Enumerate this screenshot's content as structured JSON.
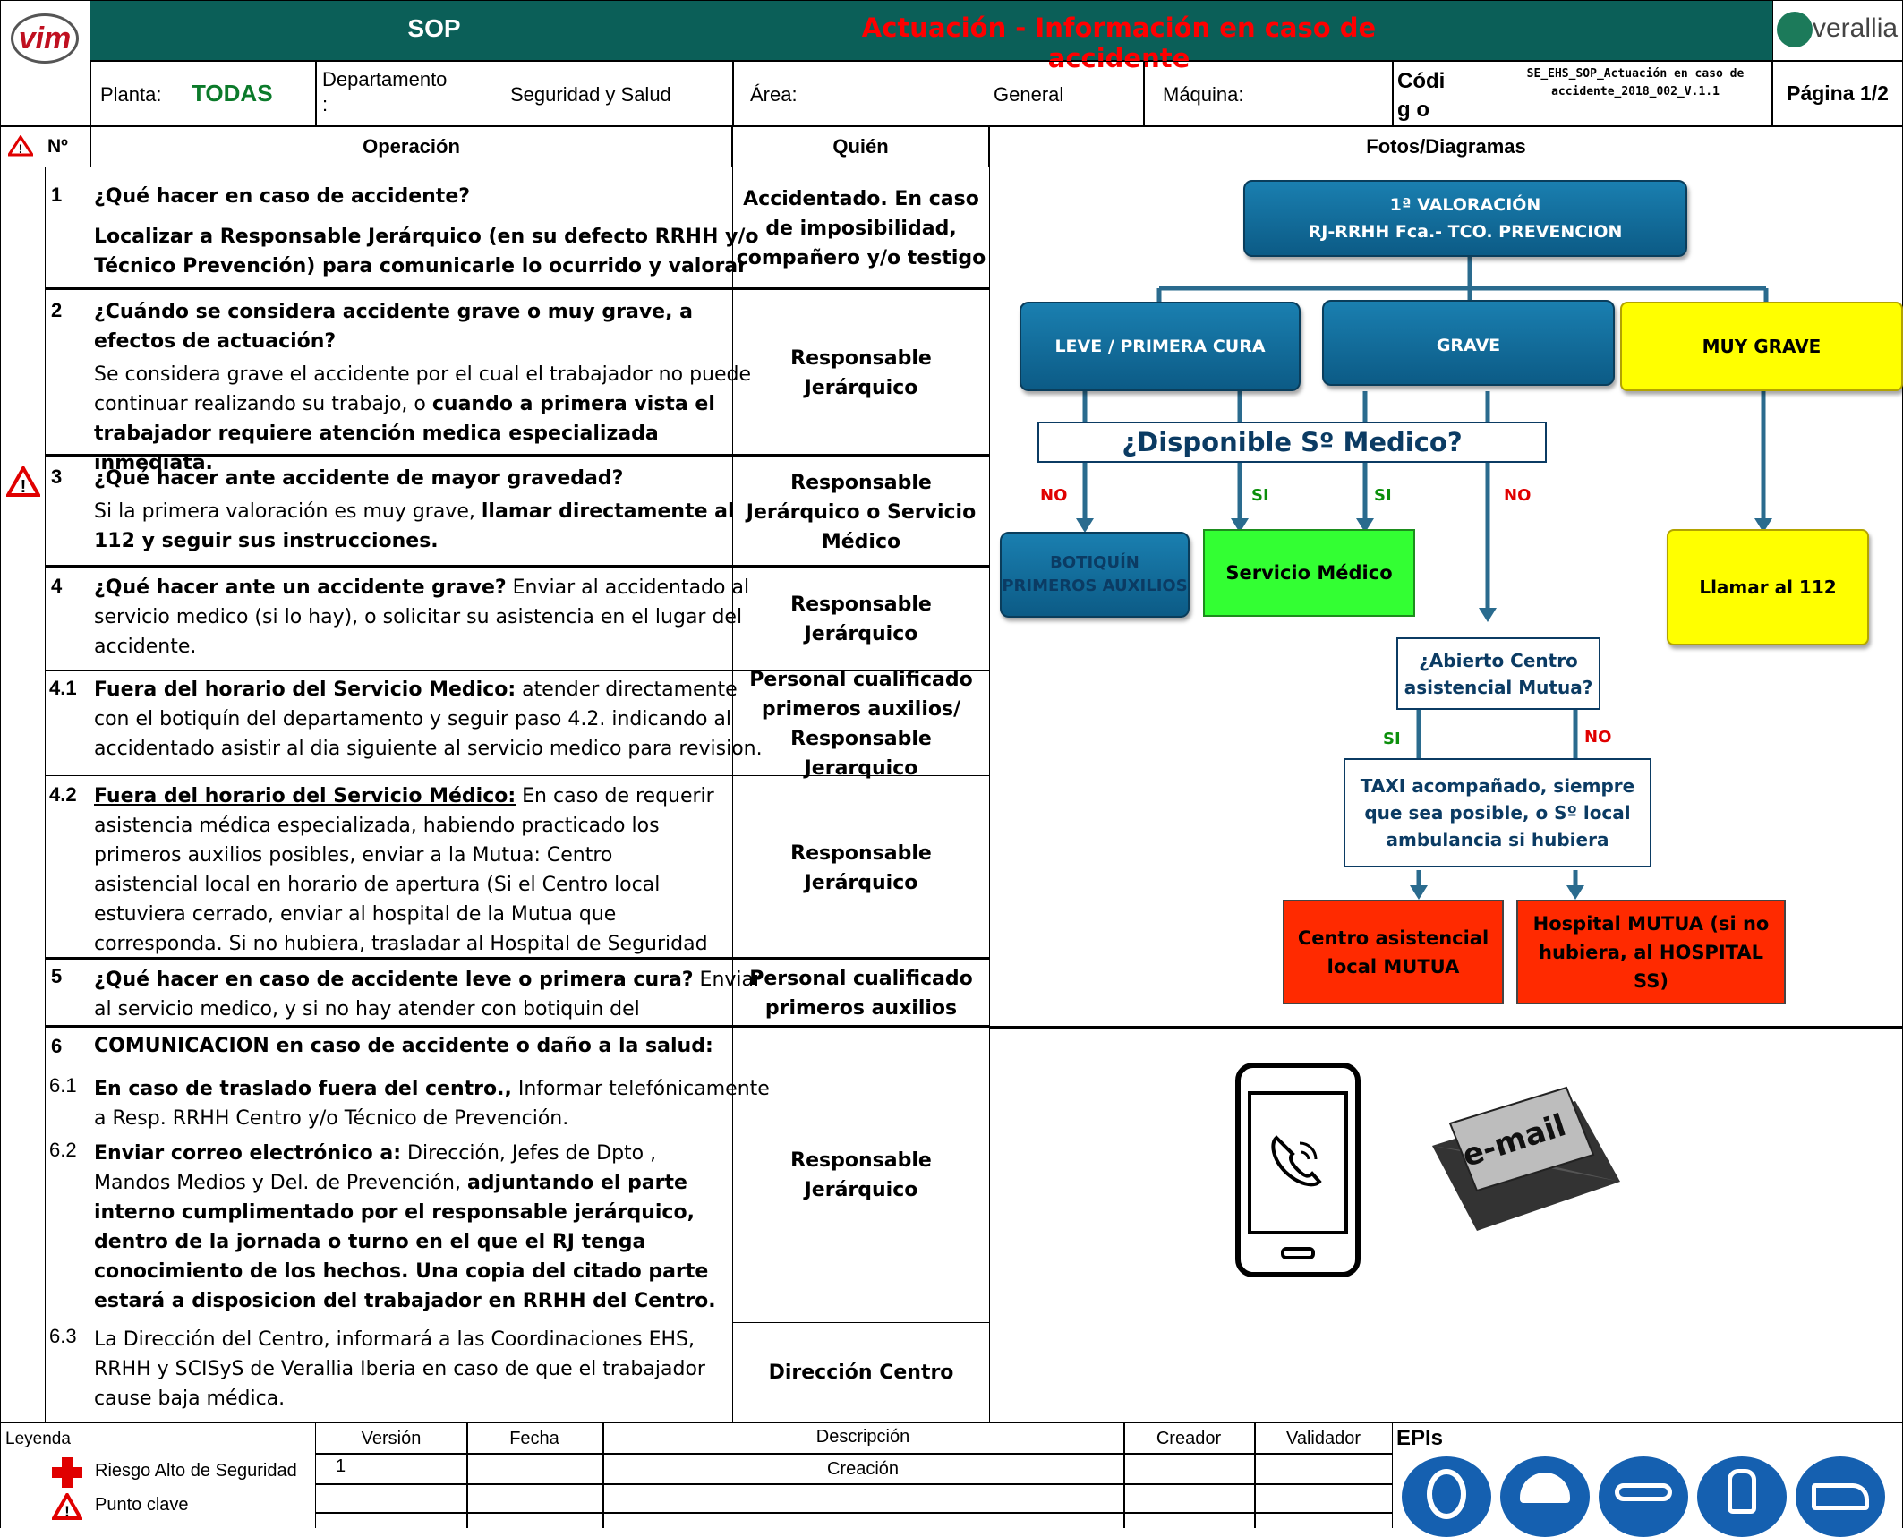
{
  "header": {
    "logo_text": "vim",
    "sop": "SOP",
    "title": "Actuación - Información en caso de accidente",
    "brand": "verallia",
    "planta_label": "Planta:",
    "planta_value": "TODAS",
    "departamento_label": "Departamento :",
    "departamento_value": "Seguridad y Salud",
    "area_label": "Área:",
    "area_value": "General",
    "maquina_label": "Máquina:",
    "codigo_label": "Códig o",
    "codigo_value": "SE_EHS_SOP_Actuación en caso de accidente_2018_002_V.1.1",
    "pagina": "Página 1/2"
  },
  "columns": {
    "num": "Nº",
    "operacion": "Operación",
    "quien": "Quién",
    "fotos": "Fotos/Diagramas"
  },
  "rows": [
    {
      "num": "1",
      "title": "¿Qué hacer en caso de accidente?",
      "body": "Localizar a Responsable Jerárquico (en su defecto RRHH y/o Técnico Prevención) para comunicarle lo ocurrido y valorar el",
      "who": "Accidentado. En caso de imposibilidad, compañero y/o testigo"
    },
    {
      "num": "2",
      "title": "¿Cuándo se considera accidente grave o muy grave, a efectos de actuación?",
      "body_a": "Se considera grave el accidente por el cual el trabajador no puede continuar realizando su trabajo, o ",
      "body_b": "cuando a primera vista el trabajador requiere atención medica especializada inmediata.",
      "who": "Responsable Jerárquico"
    },
    {
      "num": "3",
      "title": "¿Qué hacer ante accidente de mayor gravedad?",
      "body_a": " Si la primera valoración es muy grave, ",
      "body_b": "llamar directamente al 112 y seguir sus instrucciones.",
      "who": "Responsable Jerárquico o Servicio Médico"
    },
    {
      "num": "4",
      "title": "¿Qué hacer ante un accidente grave?",
      "body": "  Enviar al accidentado al servicio medico (si lo hay), o solicitar su asistencia en el lugar del accidente.",
      "who": "Responsable Jerárquico"
    },
    {
      "num": "4.1",
      "title": "Fuera del horario del Servicio Medico:",
      "body": " atender directamente con el botiquín del departamento y seguir paso 4.2. indicando al accidentado asistir al dia siguiente al servicio medico para revision.",
      "who": "Personal cualificado primeros auxilios/ Responsable Jerarquico"
    },
    {
      "num": "4.2",
      "title": "Fuera del horario del Servicio Médico:",
      "body": " En caso de requerir asistencia médica especializada, habiendo practicado los primeros auxilios posibles, enviar a la Mutua: Centro asistencial local en horario de apertura (Si el Centro local estuviera cerrado, enviar al hospital de la Mutua que corresponda. Si no hubiera, trasladar al Hospital de Seguridad",
      "who": "Responsable Jerárquico"
    },
    {
      "num": "5",
      "title": "¿Qué hacer en caso de accidente leve o primera cura?",
      "body": " Enviar al servicio medico, y si no hay atender con botiquin del",
      "who": "Personal cualificado primeros auxilios"
    },
    {
      "num": "6",
      "title": "COMUNICACION en caso de accidente o daño a la salud:"
    },
    {
      "num": "6.1",
      "title": "En caso de traslado fuera del centro.,",
      "body": " Informar telefónicamente a Resp. RRHH Centro y/o Técnico de Prevención."
    },
    {
      "num": "6.2",
      "title": "Enviar correo electrónico a:",
      "body": " Dirección, Jefes de Dpto , Mandos Medios y Del. de Prevención, ",
      "body_b": "adjuntando el parte interno cumplimentado por el responsable jerárquico, dentro de la jornada o turno en el que el RJ tenga conocimiento de los hechos. Una copia del citado parte estará a disposicion del trabajador en RRHH del Centro.",
      "who": "Responsable Jerárquico"
    },
    {
      "num": "6.3",
      "body": "La Dirección del Centro, informará a las Coordinaciones EHS, RRHH y SCISyS de Verallia Iberia en caso de que el trabajador cause baja médica.",
      "who": "Dirección Centro"
    }
  ],
  "flow": {
    "valoracion": "1ª VALORACIÓN RJ-RRHH Fca.- TCO. PREVENCION",
    "valoracion_l1": "1ª VALORACIÓN",
    "valoracion_l2": "RJ-RRHH Fca.- TCO. PREVENCION",
    "leve": "LEVE / PRIMERA CURA",
    "grave": "GRAVE",
    "muy_grave": "MUY GRAVE",
    "disponible": "¿Disponible Sº Medico?",
    "no": "NO",
    "si": "SI",
    "botiquin": "BOTIQUÍN PRIMEROS AUXILIOS",
    "servicio_medico": "Servicio Médico",
    "llamar_112": "Llamar al 112",
    "abierto": "¿Abierto Centro asistencial Mutua?",
    "taxi": "TAXI acompañado, siempre que sea posible, o Sº local ambulancia si hubiera",
    "centro_local": "Centro asistencial local MUTUA",
    "hospital": "Hospital MUTUA (si no hubiera, al HOSPITAL SS)",
    "email_label": "e-mail"
  },
  "legend": {
    "title": "Leyenda",
    "riesgo": "Riesgo Alto de Seguridad",
    "punto": "Punto clave"
  },
  "versions": {
    "headers": [
      "Versión",
      "Fecha",
      "Descripción",
      "Creador",
      "Validador"
    ],
    "row": [
      "1",
      "",
      "Creación",
      "",
      ""
    ]
  },
  "epis": {
    "title": "EPIs"
  },
  "colors": {
    "band": "#0b5f58",
    "title_red": "#ff0000",
    "blue_box": "#1a7fb0",
    "yellow": "#ffff00",
    "green": "#33ff33",
    "red": "#ff2a00"
  }
}
